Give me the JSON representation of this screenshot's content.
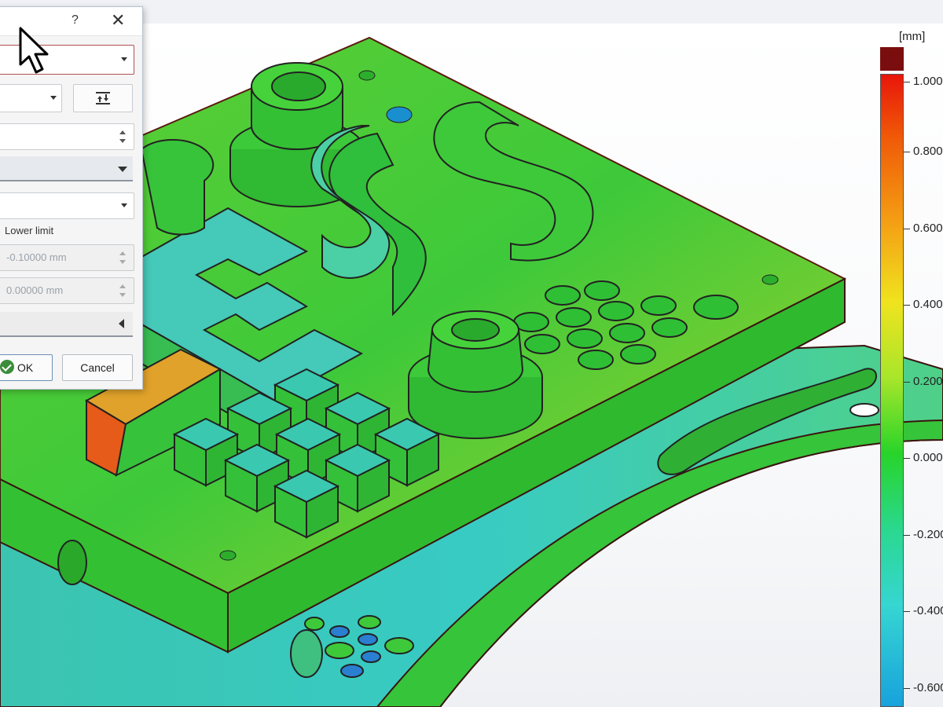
{
  "dialog": {
    "help_glyph": "?",
    "close_glyph": "✕",
    "lower_limit_label": "Lower limit",
    "lower_limit_value": "-0.10000 mm",
    "second_value": "0.00000 mm",
    "ok_label": "OK",
    "cancel_label": "Cancel"
  },
  "legend": {
    "unit": "[mm]",
    "ticks": [
      "1.000",
      "0.800",
      "0.600",
      "0.400",
      "0.200",
      "0.000",
      "-0.200",
      "-0.400",
      "-0.600"
    ],
    "over_color": "#7a0e0e",
    "scale_colors": [
      "#e8160a",
      "#f4a214",
      "#f0e31e",
      "#28d42a",
      "#36d6d2",
      "#18a2dc"
    ]
  },
  "icons": {
    "cursor": "mouse-pointer-icon",
    "ok": "check-circle-icon",
    "align": "align-icon"
  },
  "scene": {
    "description_colors": {
      "plate_top": "#3ec93a",
      "plate_front": "#2fb92f",
      "deviation_low": "#3cc7c9",
      "deviation_high": "#e94a1c"
    }
  }
}
